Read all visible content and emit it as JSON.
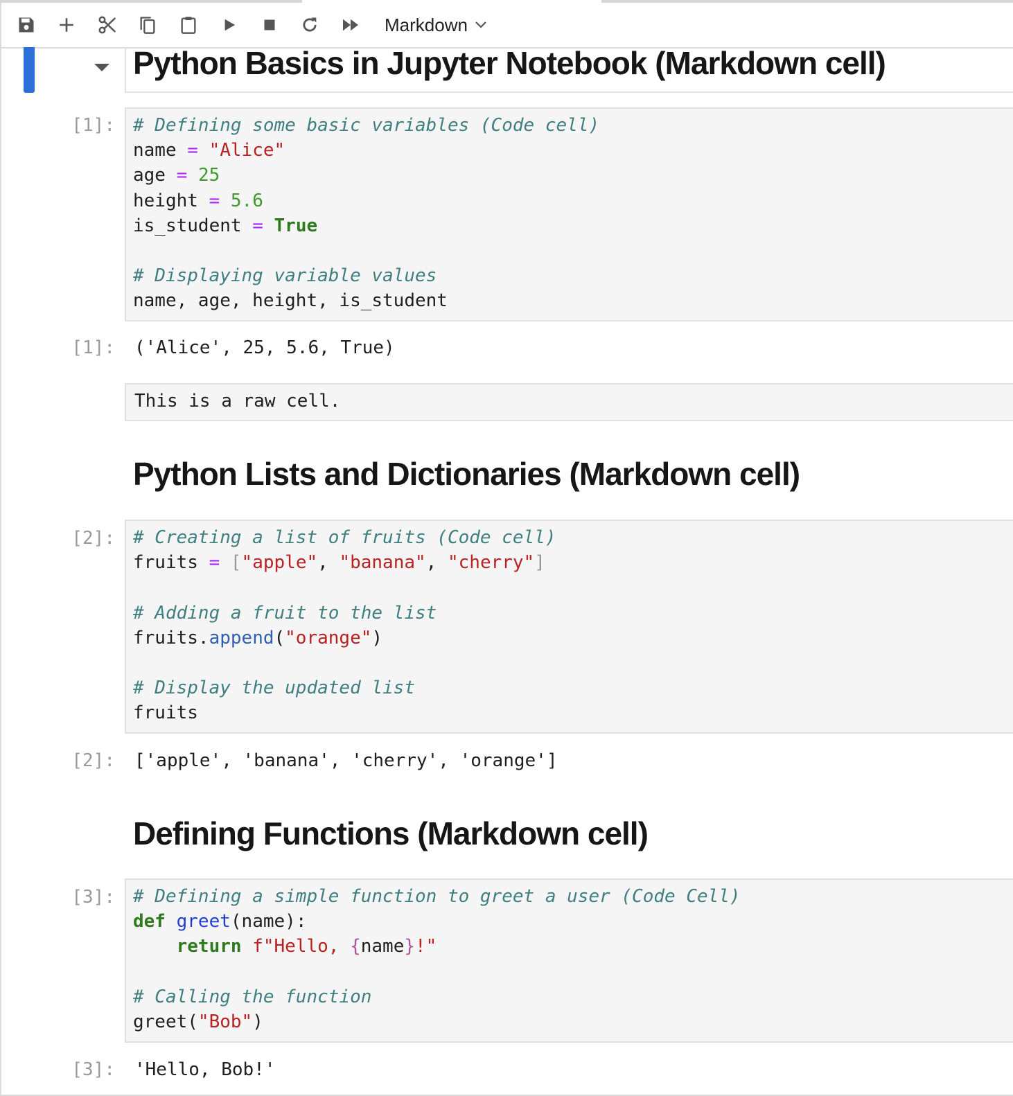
{
  "toolbar": {
    "buttons": [
      "save-icon",
      "plus-icon",
      "scissors-icon",
      "copy-icon",
      "paste-icon",
      "run-icon",
      "stop-icon",
      "restart-icon",
      "fast-forward-icon"
    ],
    "cell_type": "Markdown"
  },
  "headings": {
    "h1": "Python Basics in Jupyter Notebook (Markdown cell)",
    "h2": "Python Lists and Dictionaries (Markdown cell)",
    "h3": "Defining Functions (Markdown cell)"
  },
  "cells": {
    "c1": {
      "prompt_in": "[1]:",
      "comment1": "# Defining some basic variables (Code cell)",
      "name_var": "name",
      "name_val": "\"Alice\"",
      "age_var": "age",
      "age_val": "25",
      "height_var": "height",
      "height_val": "5.6",
      "student_var": "is_student",
      "student_val": "True",
      "comment2": "# Displaying variable values",
      "display_line": "name, age, height, is_student",
      "prompt_out": "[1]:",
      "output": "('Alice', 25, 5.6, True)"
    },
    "raw": {
      "text": "This is a raw cell."
    },
    "c2": {
      "prompt_in": "[2]:",
      "comment1": "# Creating a list of fruits (Code cell)",
      "fruits_var": "fruits",
      "item1": "\"apple\"",
      "item2": "\"banana\"",
      "item3": "\"cherry\"",
      "comment2": "# Adding a fruit to the list",
      "append_obj": "fruits.",
      "append_fn": "append",
      "append_arg": "\"orange\"",
      "comment3": "# Display the updated list",
      "display_line": "fruits",
      "prompt_out": "[2]:",
      "output": "['apple', 'banana', 'cherry', 'orange']"
    },
    "c3": {
      "prompt_in": "[3]:",
      "comment1": "# Defining a simple function to greet a user (Code Cell)",
      "def_kw": "def",
      "fn_name": "greet",
      "fn_params": "(name):",
      "return_kw": "return",
      "fstring_start": "f\"Hello, ",
      "interp_open": "{",
      "interp_var": "name",
      "interp_close": "}",
      "fstring_end": "!\"",
      "comment2": "# Calling the function",
      "call_fn": "greet(",
      "call_arg": "\"Bob\"",
      "call_close": ")",
      "prompt_out": "[3]:",
      "output": "'Hello, Bob!'"
    }
  }
}
